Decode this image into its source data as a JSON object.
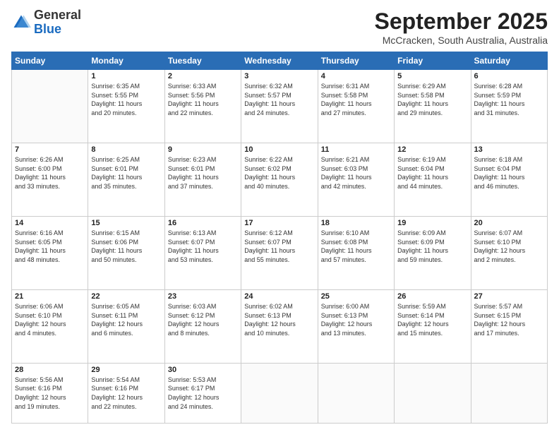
{
  "header": {
    "logo_general": "General",
    "logo_blue": "Blue",
    "month": "September 2025",
    "location": "McCracken, South Australia, Australia"
  },
  "weekdays": [
    "Sunday",
    "Monday",
    "Tuesday",
    "Wednesday",
    "Thursday",
    "Friday",
    "Saturday"
  ],
  "weeks": [
    [
      {
        "day": "",
        "text": ""
      },
      {
        "day": "1",
        "text": "Sunrise: 6:35 AM\nSunset: 5:55 PM\nDaylight: 11 hours\nand 20 minutes."
      },
      {
        "day": "2",
        "text": "Sunrise: 6:33 AM\nSunset: 5:56 PM\nDaylight: 11 hours\nand 22 minutes."
      },
      {
        "day": "3",
        "text": "Sunrise: 6:32 AM\nSunset: 5:57 PM\nDaylight: 11 hours\nand 24 minutes."
      },
      {
        "day": "4",
        "text": "Sunrise: 6:31 AM\nSunset: 5:58 PM\nDaylight: 11 hours\nand 27 minutes."
      },
      {
        "day": "5",
        "text": "Sunrise: 6:29 AM\nSunset: 5:58 PM\nDaylight: 11 hours\nand 29 minutes."
      },
      {
        "day": "6",
        "text": "Sunrise: 6:28 AM\nSunset: 5:59 PM\nDaylight: 11 hours\nand 31 minutes."
      }
    ],
    [
      {
        "day": "7",
        "text": "Sunrise: 6:26 AM\nSunset: 6:00 PM\nDaylight: 11 hours\nand 33 minutes."
      },
      {
        "day": "8",
        "text": "Sunrise: 6:25 AM\nSunset: 6:01 PM\nDaylight: 11 hours\nand 35 minutes."
      },
      {
        "day": "9",
        "text": "Sunrise: 6:23 AM\nSunset: 6:01 PM\nDaylight: 11 hours\nand 37 minutes."
      },
      {
        "day": "10",
        "text": "Sunrise: 6:22 AM\nSunset: 6:02 PM\nDaylight: 11 hours\nand 40 minutes."
      },
      {
        "day": "11",
        "text": "Sunrise: 6:21 AM\nSunset: 6:03 PM\nDaylight: 11 hours\nand 42 minutes."
      },
      {
        "day": "12",
        "text": "Sunrise: 6:19 AM\nSunset: 6:04 PM\nDaylight: 11 hours\nand 44 minutes."
      },
      {
        "day": "13",
        "text": "Sunrise: 6:18 AM\nSunset: 6:04 PM\nDaylight: 11 hours\nand 46 minutes."
      }
    ],
    [
      {
        "day": "14",
        "text": "Sunrise: 6:16 AM\nSunset: 6:05 PM\nDaylight: 11 hours\nand 48 minutes."
      },
      {
        "day": "15",
        "text": "Sunrise: 6:15 AM\nSunset: 6:06 PM\nDaylight: 11 hours\nand 50 minutes."
      },
      {
        "day": "16",
        "text": "Sunrise: 6:13 AM\nSunset: 6:07 PM\nDaylight: 11 hours\nand 53 minutes."
      },
      {
        "day": "17",
        "text": "Sunrise: 6:12 AM\nSunset: 6:07 PM\nDaylight: 11 hours\nand 55 minutes."
      },
      {
        "day": "18",
        "text": "Sunrise: 6:10 AM\nSunset: 6:08 PM\nDaylight: 11 hours\nand 57 minutes."
      },
      {
        "day": "19",
        "text": "Sunrise: 6:09 AM\nSunset: 6:09 PM\nDaylight: 11 hours\nand 59 minutes."
      },
      {
        "day": "20",
        "text": "Sunrise: 6:07 AM\nSunset: 6:10 PM\nDaylight: 12 hours\nand 2 minutes."
      }
    ],
    [
      {
        "day": "21",
        "text": "Sunrise: 6:06 AM\nSunset: 6:10 PM\nDaylight: 12 hours\nand 4 minutes."
      },
      {
        "day": "22",
        "text": "Sunrise: 6:05 AM\nSunset: 6:11 PM\nDaylight: 12 hours\nand 6 minutes."
      },
      {
        "day": "23",
        "text": "Sunrise: 6:03 AM\nSunset: 6:12 PM\nDaylight: 12 hours\nand 8 minutes."
      },
      {
        "day": "24",
        "text": "Sunrise: 6:02 AM\nSunset: 6:13 PM\nDaylight: 12 hours\nand 10 minutes."
      },
      {
        "day": "25",
        "text": "Sunrise: 6:00 AM\nSunset: 6:13 PM\nDaylight: 12 hours\nand 13 minutes."
      },
      {
        "day": "26",
        "text": "Sunrise: 5:59 AM\nSunset: 6:14 PM\nDaylight: 12 hours\nand 15 minutes."
      },
      {
        "day": "27",
        "text": "Sunrise: 5:57 AM\nSunset: 6:15 PM\nDaylight: 12 hours\nand 17 minutes."
      }
    ],
    [
      {
        "day": "28",
        "text": "Sunrise: 5:56 AM\nSunset: 6:16 PM\nDaylight: 12 hours\nand 19 minutes."
      },
      {
        "day": "29",
        "text": "Sunrise: 5:54 AM\nSunset: 6:16 PM\nDaylight: 12 hours\nand 22 minutes."
      },
      {
        "day": "30",
        "text": "Sunrise: 5:53 AM\nSunset: 6:17 PM\nDaylight: 12 hours\nand 24 minutes."
      },
      {
        "day": "",
        "text": ""
      },
      {
        "day": "",
        "text": ""
      },
      {
        "day": "",
        "text": ""
      },
      {
        "day": "",
        "text": ""
      }
    ]
  ]
}
